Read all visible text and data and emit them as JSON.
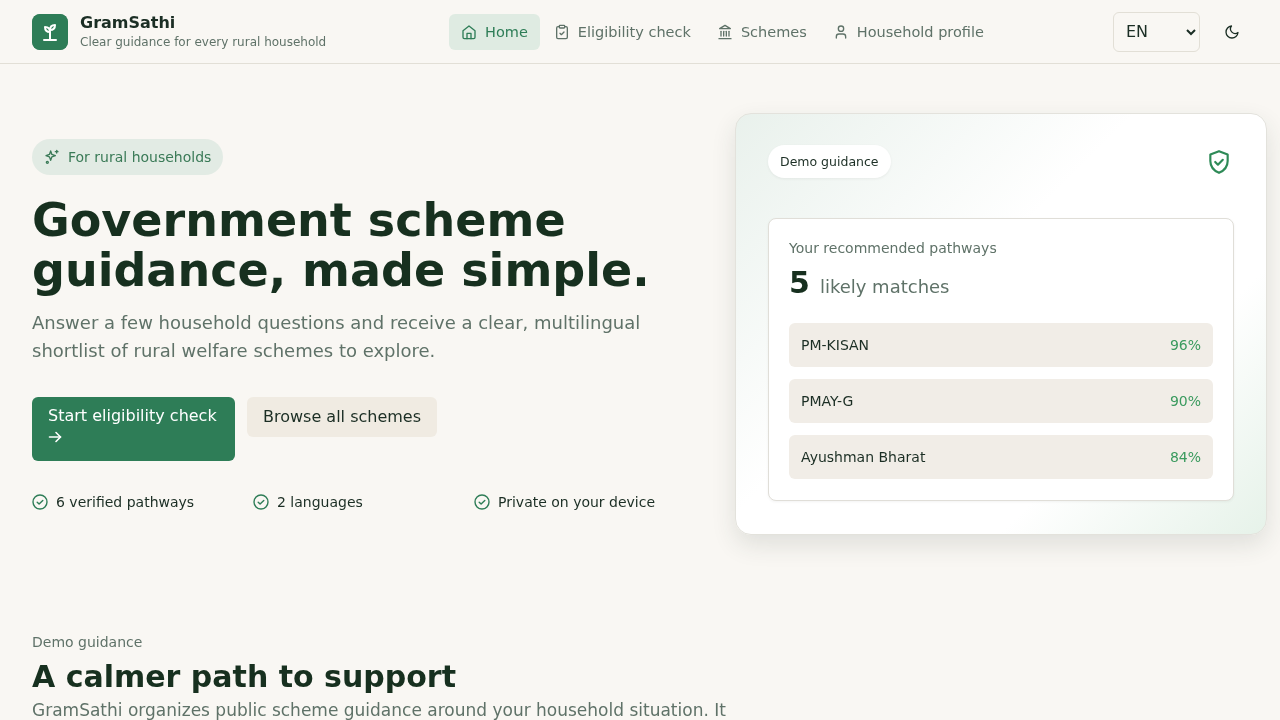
{
  "header": {
    "brand": {
      "name": "GramSathi",
      "tagline": "Clear guidance for every rural household"
    },
    "nav": [
      {
        "label": "Home",
        "kind": "home",
        "selected": true
      },
      {
        "label": "Eligibility check",
        "kind": "clipboard",
        "selected": false
      },
      {
        "label": "Schemes",
        "kind": "bank",
        "selected": false
      },
      {
        "label": "Household profile",
        "kind": "user",
        "selected": false
      }
    ],
    "language": {
      "value": "EN"
    }
  },
  "hero": {
    "badge": "For rural households",
    "title": "Government scheme guidance, made simple.",
    "subtitle": "Answer a few household questions and receive a clear, multilingual shortlist of rural welfare schemes to explore.",
    "buttons": [
      {
        "label": "Start eligibility check",
        "kind": "primary"
      },
      {
        "label": "Browse all schemes",
        "kind": "secondary"
      }
    ],
    "highlights": [
      "6 verified pathways",
      "2 languages",
      "Private on your device"
    ]
  },
  "preview_card": {
    "tag": "Demo guidance",
    "heading": "Your recommended pathways",
    "count": "5",
    "count_label": "likely matches",
    "matches": [
      {
        "name": "PM-KISAN",
        "score": "96%"
      },
      {
        "name": "PMAY-G",
        "score": "90%"
      },
      {
        "name": "Ayushman Bharat",
        "score": "84%"
      }
    ]
  },
  "section": {
    "eyebrow": "Demo guidance",
    "title": "A calmer path to support",
    "text": "GramSathi organizes public scheme guidance around your household situation. It"
  }
}
